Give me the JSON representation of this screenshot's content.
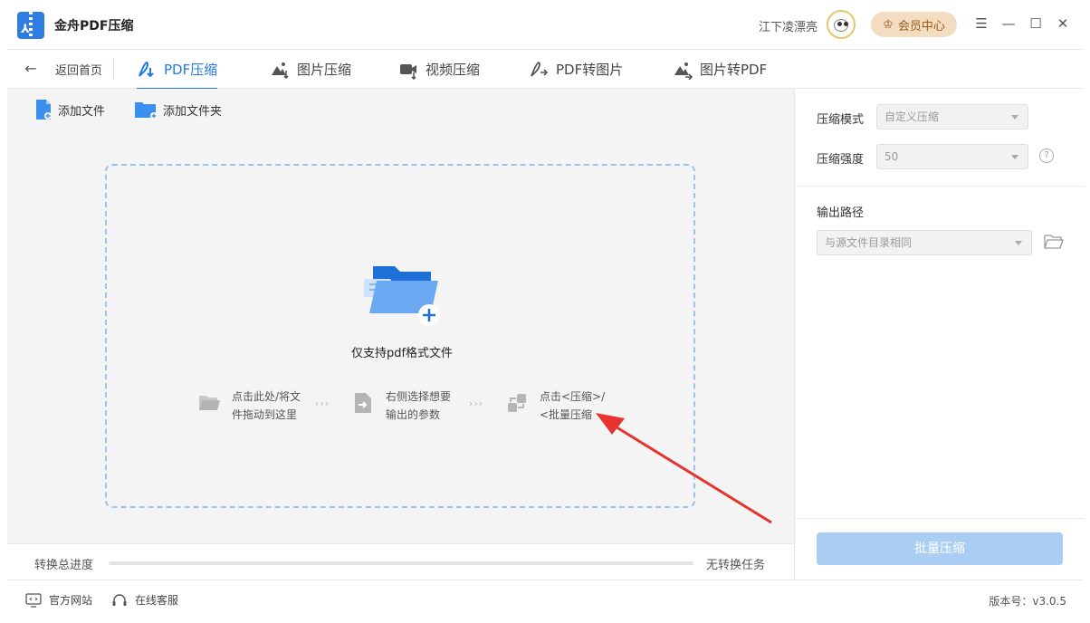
{
  "app": {
    "title": "金舟PDF压缩"
  },
  "user": {
    "name": "江下凌漂亮",
    "vip_label": "会员中心"
  },
  "window_controls": {
    "menu": "☰",
    "minimize": "—",
    "maximize": "☐",
    "close": "✕"
  },
  "nav": {
    "back_label": "返回首页",
    "tabs": [
      {
        "label": "PDF压缩",
        "active": true
      },
      {
        "label": "图片压缩",
        "active": false
      },
      {
        "label": "视频压缩",
        "active": false
      },
      {
        "label": "PDF转图片",
        "active": false
      },
      {
        "label": "图片转PDF",
        "active": false
      }
    ]
  },
  "toolbar": {
    "add_file": "添加文件",
    "add_folder": "添加文件夹"
  },
  "dropzone": {
    "support_text": "仅支持pdf格式文件",
    "steps": [
      {
        "line1": "点击此处/将文",
        "line2": "件拖动到这里"
      },
      {
        "line1": "右侧选择想要",
        "line2": "输出的参数"
      },
      {
        "line1": "点击<压缩>/",
        "line2": "<批量压缩"
      }
    ],
    "chevron": "›››"
  },
  "progress": {
    "label": "转换总进度",
    "status": "无转换任务",
    "value": 0
  },
  "settings": {
    "mode_label": "压缩模式",
    "mode_value": "自定义压缩",
    "strength_label": "压缩强度",
    "strength_value": "50",
    "help": "?",
    "output_label": "输出路径",
    "output_value": "与源文件目录相同",
    "batch_button": "批量压缩"
  },
  "statusbar": {
    "website": "官方网站",
    "support": "在线客服",
    "version": "版本号：v3.0.5"
  },
  "colors": {
    "accent": "#1f79e6",
    "batch_button": "#a9cdf3",
    "vip_bg": "#f3ddc0",
    "annotation": "#e8322d"
  }
}
